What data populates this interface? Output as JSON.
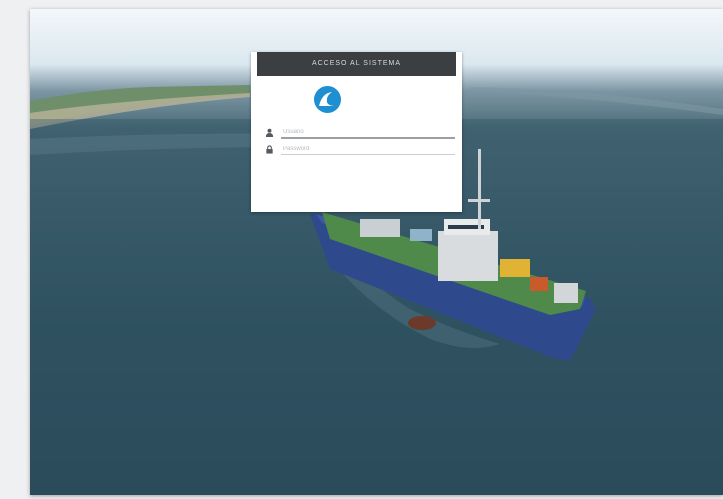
{
  "login": {
    "header_title": "ACCESO AL SISTEMA",
    "logo_small": "",
    "logo_name": "",
    "username_placeholder": "Usuario",
    "password_placeholder": "Password",
    "link_left": "",
    "link_right": ""
  },
  "colors": {
    "header_bg": "#3b3f42",
    "brand_blue": "#1e8fd0",
    "sea": "#2f5260",
    "hull": "#2f4a8c"
  },
  "icons": {
    "username": "user-icon",
    "password": "lock-icon",
    "logo": "wave-logo-icon"
  }
}
